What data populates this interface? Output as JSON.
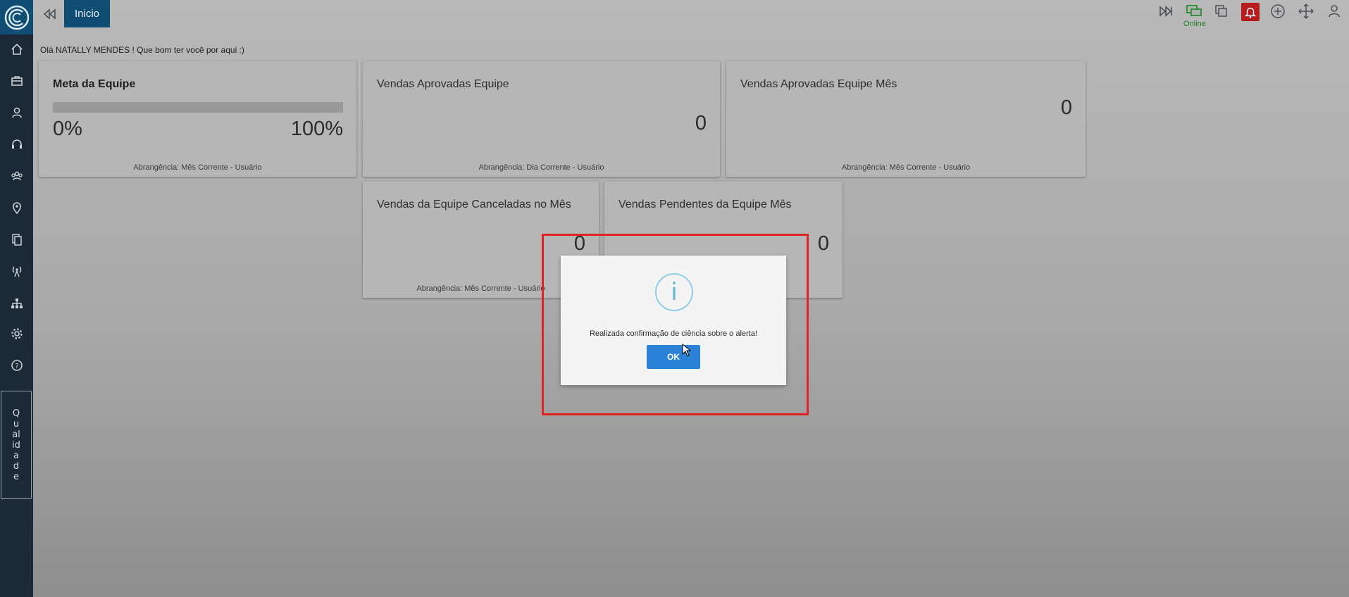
{
  "topbar": {
    "tab_label": "Inicio",
    "status_label": "Online",
    "icons": [
      "fast-forward-icon",
      "chat-monitor-icon",
      "copy-icon",
      "bell-icon",
      "plus-circle-icon",
      "move-icon",
      "user-icon"
    ]
  },
  "sidebar": {
    "items": [
      "home-icon",
      "briefcase-icon",
      "user-icon",
      "headset-icon",
      "users-icon",
      "location-pin-icon",
      "documents-icon",
      "antenna-icon",
      "hierarchy-icon",
      "gear-icon",
      "help-icon"
    ],
    "quality_label": "Qualidade"
  },
  "greeting": "Olá NATALLY MENDES ! Que bom ter você por aqui :)",
  "cards": {
    "meta": {
      "title": "Meta da Equipe",
      "progress": 0,
      "left_label": "0%",
      "right_label": "100%",
      "footer": "Abrangência: Mês Corrente - Usuário"
    },
    "aprovadas": {
      "title": "Vendas Aprovadas Equipe",
      "value": "0",
      "footer": "Abrangência: Dia Corrente - Usuário"
    },
    "aprovadas_mes": {
      "title": "Vendas Aprovadas Equipe Mês",
      "value": "0",
      "footer": "Abrangência: Mês Corrente - Usuário"
    },
    "canceladas": {
      "title": "Vendas da Equipe Canceladas no Mês",
      "value": "0",
      "footer": "Abrangência: Mês Corrente - Usuário"
    },
    "pendentes": {
      "title": "Vendas Pendentes da Equipe Mês",
      "value": "0"
    }
  },
  "dialog": {
    "icon": "info-icon",
    "icon_glyph": "i",
    "message": "Realizada confirmação de ciência sobre o alerta!",
    "ok_label": "OK"
  },
  "colors": {
    "sidebar": "#1b2a36",
    "brand": "#0f4d72",
    "ok_button": "#2b81d6",
    "highlight": "#e02424",
    "bell": "#b71c1c",
    "online": "#1e7a25"
  }
}
